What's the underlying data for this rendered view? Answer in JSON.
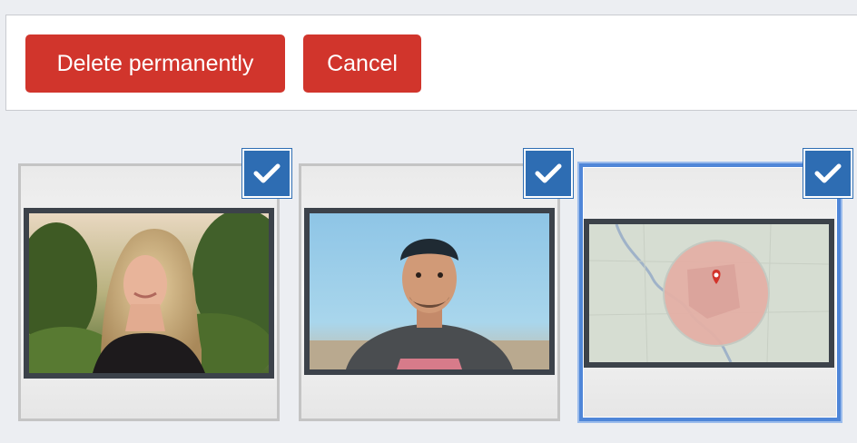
{
  "toolbar": {
    "delete_label": "Delete permanently",
    "cancel_label": "Cancel"
  },
  "colors": {
    "button_bg": "#d1352c",
    "check_bg": "#2e6db3",
    "selected_border": "#4f86d8"
  },
  "attachments": [
    {
      "thumbnail": "photo-woman-portrait",
      "selected": true
    },
    {
      "thumbnail": "photo-man-portrait",
      "selected": true
    },
    {
      "thumbnail": "map-location-radius",
      "selected": true
    }
  ]
}
